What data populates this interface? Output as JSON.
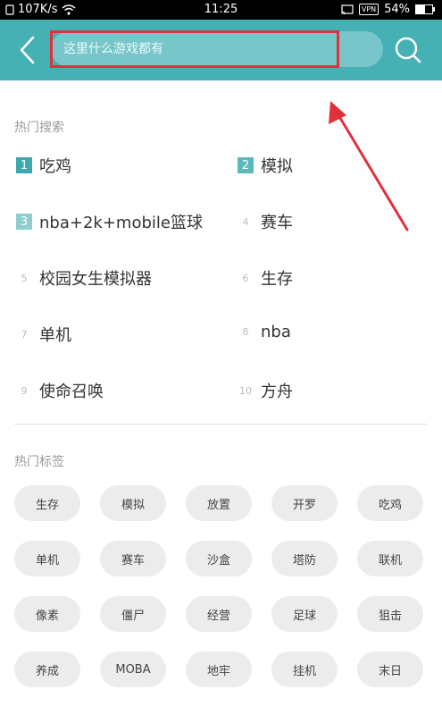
{
  "status_bar": {
    "left_speed": "107K/s",
    "time": "11:25",
    "vpn": "VPN",
    "battery": "54%",
    "battery_level": 0.54
  },
  "header": {
    "search_placeholder": "这里什么游戏都有",
    "accent_color": "#45b1b4",
    "annotation_color": "#e0313b"
  },
  "hot_search": {
    "title": "热门搜索",
    "items": [
      {
        "rank": "1",
        "label": "吃鸡"
      },
      {
        "rank": "2",
        "label": "模拟"
      },
      {
        "rank": "3",
        "label": "nba+2k+mobile篮球"
      },
      {
        "rank": "4",
        "label": "赛车"
      },
      {
        "rank": "5",
        "label": "校园女生模拟器"
      },
      {
        "rank": "6",
        "label": "生存"
      },
      {
        "rank": "7",
        "label": "单机"
      },
      {
        "rank": "8",
        "label": "nba"
      },
      {
        "rank": "9",
        "label": "使命召唤"
      },
      {
        "rank": "10",
        "label": "方舟"
      }
    ]
  },
  "hot_tags": {
    "title": "热门标签",
    "tags": [
      "生存",
      "模拟",
      "放置",
      "开罗",
      "吃鸡",
      "单机",
      "赛车",
      "沙盒",
      "塔防",
      "联机",
      "像素",
      "僵尸",
      "经营",
      "足球",
      "狙击",
      "养成",
      "MOBA",
      "地牢",
      "挂机",
      "末日"
    ]
  }
}
